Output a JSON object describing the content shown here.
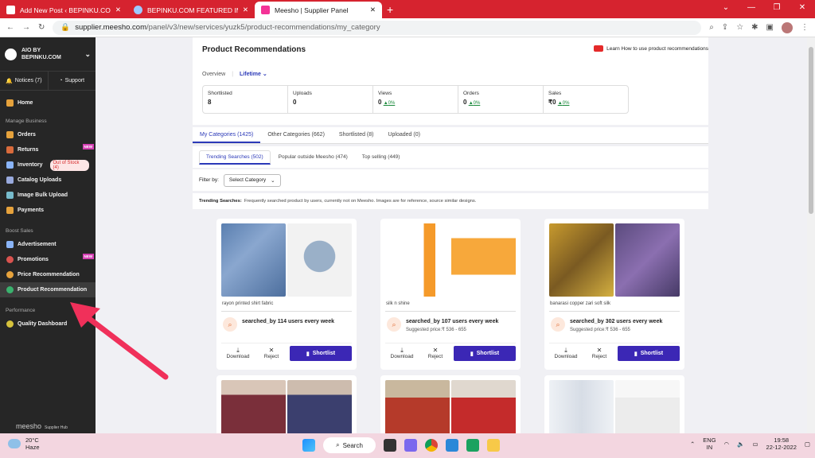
{
  "browser": {
    "tabs": [
      {
        "title": "Add New Post ‹ BEPINKU.COM —",
        "active": false
      },
      {
        "title": "BEPINKU.COM FEATURED IMAGE",
        "active": false
      },
      {
        "title": "Meesho | Supplier Panel",
        "active": true
      }
    ],
    "new_tab": "+",
    "url_host": "supplier.meesho.com",
    "url_path": "/panel/v3/new/services/yuzk5/product-recommendations/my_category"
  },
  "sidebar": {
    "account": "AIO BY BEPINKU.COM",
    "notices": "Notices (7)",
    "support": "Support",
    "home": "Home",
    "sec_manage": "Manage Business",
    "orders": "Orders",
    "returns": "Returns",
    "inventory": "Inventory",
    "out_of_stock": "Out of Stock (4)",
    "catalog": "Catalog Uploads",
    "bulk": "Image Bulk Upload",
    "payments": "Payments",
    "sec_boost": "Boost Sales",
    "advertisement": "Advertisement",
    "promotions": "Promotions",
    "price_rec": "Price Recommendation",
    "product_rec": "Product Recommendation",
    "sec_perf": "Performance",
    "quality": "Quality Dashboard",
    "new_badge": "NEW",
    "footer_brand": "meesho",
    "footer_sub": "Supplier Hub"
  },
  "page": {
    "title": "Product Recommendations",
    "learn": "Learn How to use product recommendations",
    "overview": "Overview",
    "lifetime": "Lifetime",
    "stats": [
      {
        "label": "Shortlisted",
        "value": "8",
        "delta": ""
      },
      {
        "label": "Uploads",
        "value": "0",
        "delta": ""
      },
      {
        "label": "Views",
        "value": "0",
        "delta": "0%"
      },
      {
        "label": "Orders",
        "value": "0",
        "delta": "0%"
      },
      {
        "label": "Sales",
        "value": "₹0",
        "delta": "0%"
      }
    ],
    "tabs": [
      "My Categories (1425)",
      "Other Categories (662)",
      "Shortlisted (8)",
      "Uploaded (0)"
    ],
    "subtabs": [
      "Trending Searches (502)",
      "Popular outside Meesho (474)",
      "Top selling (449)"
    ],
    "filter_label": "Filter by:",
    "filter_select": "Select Category",
    "trend_label": "Trending Searches:",
    "trend_text": "Frequently searched product by users, currently not on Meesho. Images are for reference, source similar designs.",
    "cards": [
      {
        "name": "rayon printed shirt fabric",
        "searched": "searched_by 114 users every week",
        "price": ""
      },
      {
        "name": "silk n shine",
        "searched": "searched_by 107 users every week",
        "price": "Suggested price:₹ 536 - 655"
      },
      {
        "name": "banarasi copper zari soft silk",
        "searched": "searched_by 302 users every week",
        "price": "Suggested price:₹ 536 - 655"
      }
    ],
    "download": "Download",
    "reject": "Reject",
    "shortlist": "Shortlist"
  },
  "taskbar": {
    "temp": "20°C",
    "weather": "Haze",
    "search": "Search",
    "lang1": "ENG",
    "lang2": "IN",
    "time": "19:58",
    "date": "22-12-2022"
  }
}
